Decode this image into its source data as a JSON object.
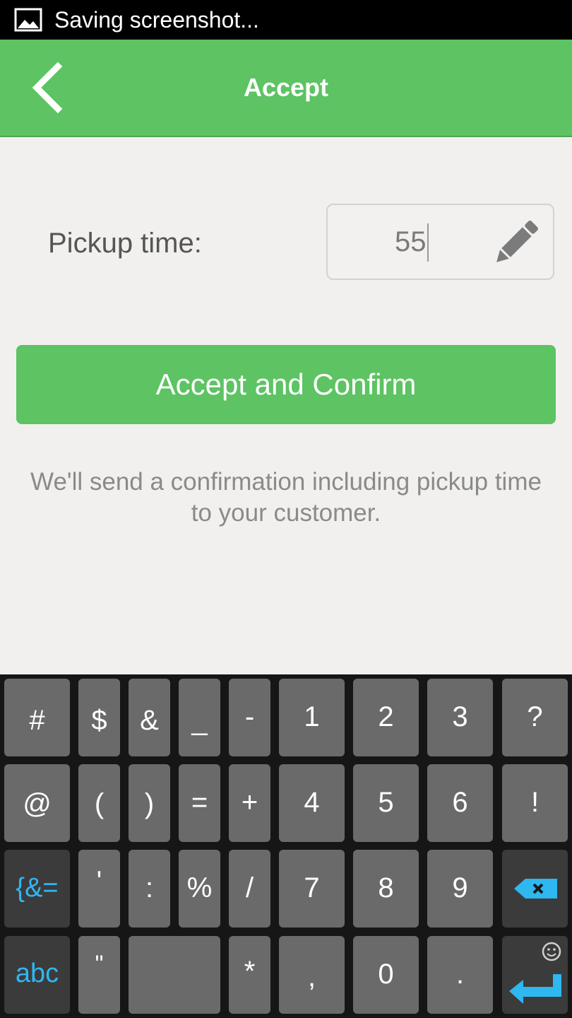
{
  "status_bar": {
    "text": "Saving screenshot..."
  },
  "app_bar": {
    "title": "Accept"
  },
  "form": {
    "pickup_label": "Pickup time:",
    "pickup_value": "55"
  },
  "accept_button": {
    "label": "Accept and Confirm"
  },
  "info_text": "We'll send a confirmation including pickup time to your customer.",
  "keyboard": {
    "rows": [
      [
        "#",
        "$",
        "&",
        "_",
        "-",
        "1",
        "2",
        "3",
        "?"
      ],
      [
        "@",
        "(",
        ")",
        "=",
        "+",
        "4",
        "5",
        "6",
        "!"
      ],
      [
        "{&=",
        "'",
        ":",
        "%",
        "/",
        "7",
        "8",
        "9",
        "backspace"
      ],
      [
        "abc",
        "\"",
        "",
        "*",
        ",",
        "0",
        ".",
        "enter"
      ]
    ]
  },
  "colors": {
    "accent": "#5dc363",
    "keyboard_bg": "#161616",
    "key": "#6a6a6a",
    "key_dark": "#3b3b3b",
    "key_blue": "#2fb7f0"
  }
}
